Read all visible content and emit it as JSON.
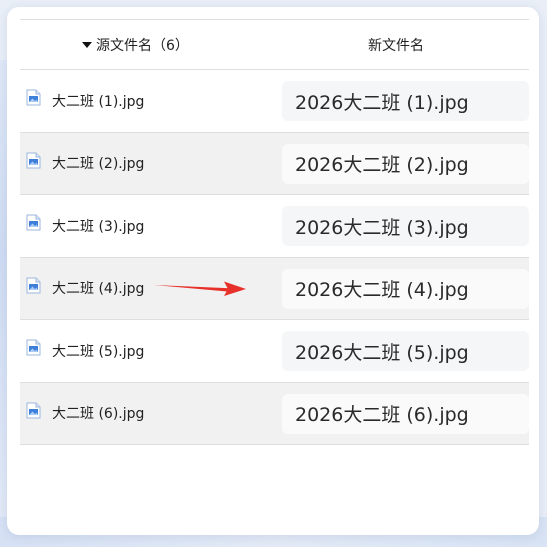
{
  "header": {
    "source_label": "源文件名（6）",
    "new_label": "新文件名"
  },
  "rows": [
    {
      "source": "大二班 (1).jpg",
      "new": "2026大二班 (1).jpg"
    },
    {
      "source": "大二班 (2).jpg",
      "new": "2026大二班 (2).jpg"
    },
    {
      "source": "大二班 (3).jpg",
      "new": "2026大二班 (3).jpg"
    },
    {
      "source": "大二班 (4).jpg",
      "new": "2026大二班 (4).jpg"
    },
    {
      "source": "大二班 (5).jpg",
      "new": "2026大二班 (5).jpg"
    },
    {
      "source": "大二班 (6).jpg",
      "new": "2026大二班 (6).jpg"
    }
  ],
  "icons": {
    "sort": "sort-down-icon",
    "file": "image-file-icon",
    "arrow": "arrow-right-icon"
  },
  "colors": {
    "arrow": "#e8302a",
    "file_icon": "#3d7fd9",
    "row_alt": "#f1f1f1"
  }
}
